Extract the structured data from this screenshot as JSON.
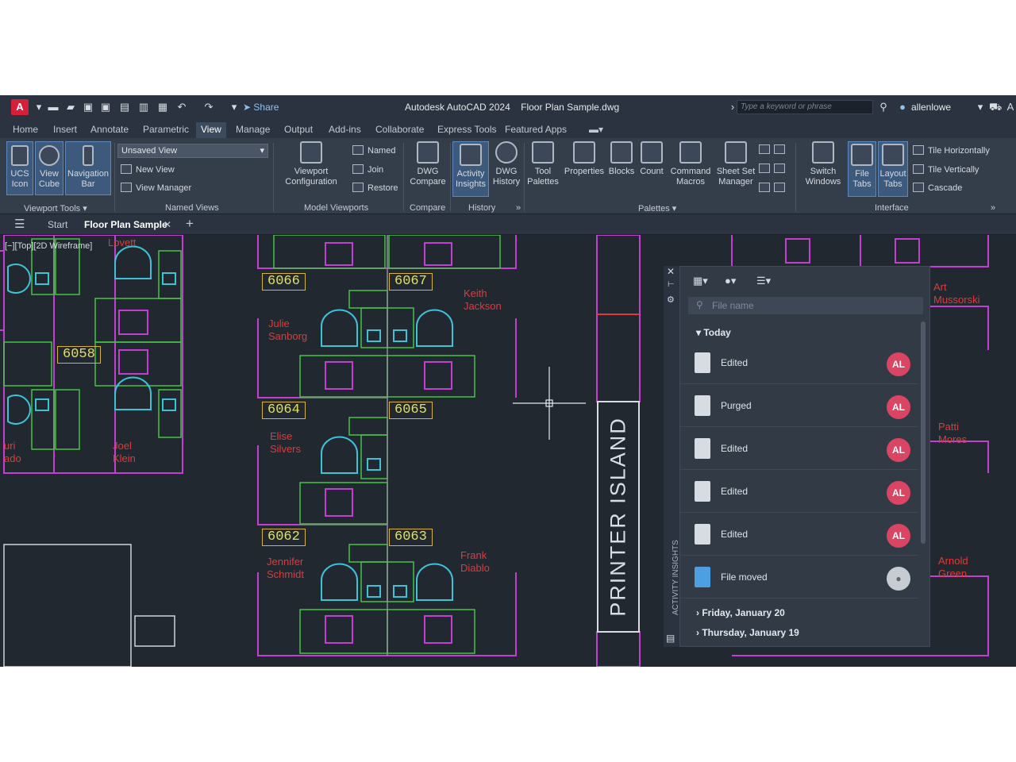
{
  "titlebar": {
    "app_title": "Autodesk AutoCAD 2024",
    "file_title": "Floor Plan Sample.dwg",
    "share_label": "Share",
    "search_placeholder": "Type a keyword or phrase",
    "username": "allenlowe",
    "logo_letter": "A"
  },
  "ribbon_tabs": [
    "Home",
    "Insert",
    "Annotate",
    "Parametric",
    "View",
    "Manage",
    "Output",
    "Add-ins",
    "Collaborate",
    "Express Tools",
    "Featured Apps"
  ],
  "ribbon": {
    "ucs_icon": "UCS\nIcon",
    "view_cube": "View\nCube",
    "navigation_bar": "Navigation\nBar",
    "viewport_tools": "Viewport Tools",
    "view_dropdown": "Unsaved View",
    "new_view": "New View",
    "view_manager": "View Manager",
    "named_views": "Named Views",
    "viewport_configuration": "Viewport\nConfiguration",
    "named": "Named",
    "join": "Join",
    "restore": "Restore",
    "model_viewports": "Model Viewports",
    "dwg_compare": "DWG\nCompare",
    "compare": "Compare",
    "activity_insights": "Activity\nInsights",
    "dwg_history": "DWG\nHistory",
    "history": "History",
    "tool_palettes": "Tool\nPalettes",
    "properties": "Properties",
    "blocks": "Blocks",
    "count": "Count",
    "command_macros": "Command\nMacros",
    "sheet_set_manager": "Sheet Set\nManager",
    "palettes": "Palettes",
    "switch_windows": "Switch\nWindows",
    "file_tabs": "File\nTabs",
    "layout_tabs": "Layout\nTabs",
    "tile_horizontally": "Tile Horizontally",
    "tile_vertically": "Tile Vertically",
    "cascade": "Cascade",
    "interface": "Interface"
  },
  "file_tabs": {
    "start": "Start",
    "active": "Floor Plan Sample"
  },
  "drawing": {
    "view_label": "[−][Top][2D Wireframe]",
    "rooms": [
      "6066",
      "6067",
      "6058",
      "6064",
      "6065",
      "6062",
      "6063"
    ],
    "people": {
      "lovett": "Lovett",
      "keith": "Keith\nJackson",
      "julie": "Julie\nSanborg",
      "elise": "Elise\nSilvers",
      "joel": "Joel\nKlein",
      "jennifer": "Jennifer\nSchmidt",
      "frank": "Frank\nDiablo",
      "art": "Art\nMussorski",
      "patti": "Patti\nMores",
      "arnold": "Arnold\nGreen",
      "yuri": "uri\nado"
    },
    "printer_island": "PRINTER ISLAND"
  },
  "activity_panel": {
    "filter_placeholder": "File name",
    "today": "Today",
    "entries": [
      {
        "label": "Edited",
        "avatar": "AL"
      },
      {
        "label": "Purged",
        "avatar": "AL"
      },
      {
        "label": "Edited",
        "avatar": "AL"
      },
      {
        "label": "Edited",
        "avatar": "AL"
      },
      {
        "label": "Edited",
        "avatar": "AL"
      },
      {
        "label": "File moved",
        "avatar": ""
      }
    ],
    "groups": [
      "Friday, January 20",
      "Thursday, January 19"
    ],
    "vertical_title": "ACTIVITY INSIGHTS"
  },
  "colors": {
    "accent": "#d94563",
    "room_tag": "#e7e058",
    "name_text": "#e03a3a",
    "wall_magenta": "#c13fd1",
    "furniture_green": "#47c247",
    "chair_cyan": "#3ec3d6"
  }
}
